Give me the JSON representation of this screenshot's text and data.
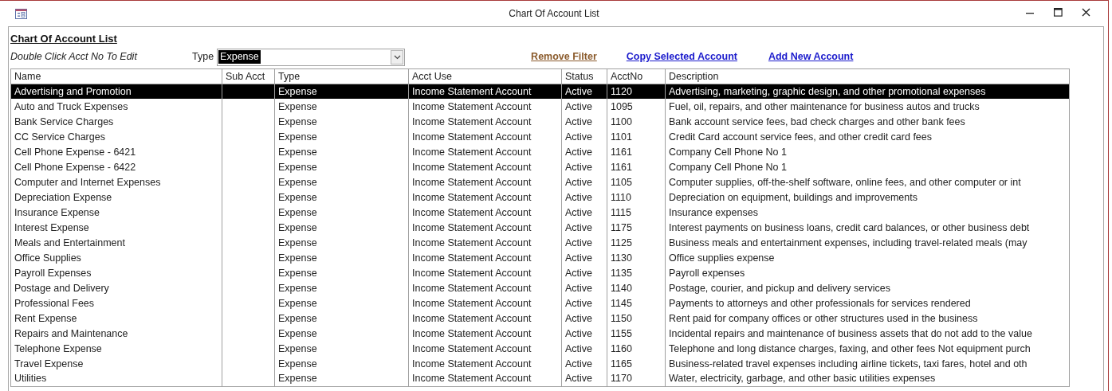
{
  "window": {
    "title": "Chart Of Account List"
  },
  "form": {
    "title": "Chart Of Account List",
    "hint": "Double Click Acct No To Edit",
    "type_filter": {
      "label": "Type",
      "value": "Expense"
    },
    "links": [
      {
        "label": "Remove Filter",
        "kind": "filter"
      },
      {
        "label": "Copy Selected Account",
        "kind": "action"
      },
      {
        "label": "Add New Account",
        "kind": "action"
      }
    ]
  },
  "table": {
    "columns": [
      "Name",
      "Sub Acct",
      "Type",
      "Acct Use",
      "Status",
      "AcctNo",
      "Description"
    ],
    "rows": [
      {
        "name": "Advertising and Promotion",
        "type": "Expense",
        "acct_use": "Income Statement Account",
        "status": "Active",
        "acct_no": "1120",
        "description": "Advertising, marketing, graphic design, and other promotional expenses",
        "selected": true
      },
      {
        "name": "Auto and Truck Expenses",
        "type": "Expense",
        "acct_use": "Income Statement Account",
        "status": "Active",
        "acct_no": "1095",
        "description": "Fuel, oil, repairs, and other maintenance for business autos and trucks",
        "selected": false
      },
      {
        "name": "Bank Service Charges",
        "type": "Expense",
        "acct_use": "Income Statement Account",
        "status": "Active",
        "acct_no": "1100",
        "description": "Bank account service fees, bad check charges and other bank fees",
        "selected": false
      },
      {
        "name": "CC Service Charges",
        "type": "Expense",
        "acct_use": "Income Statement Account",
        "status": "Active",
        "acct_no": "1101",
        "description": "Credit Card account service fees, and other credit card fees",
        "selected": false
      },
      {
        "name": "Cell Phone Expense - 6421",
        "type": "Expense",
        "acct_use": "Income Statement Account",
        "status": "Active",
        "acct_no": "1161",
        "description": "Company Cell Phone No 1",
        "selected": false
      },
      {
        "name": "Cell Phone Expense - 6422",
        "type": "Expense",
        "acct_use": "Income Statement Account",
        "status": "Active",
        "acct_no": "1161",
        "description": "Company Cell Phone No 1",
        "selected": false
      },
      {
        "name": "Computer and Internet Expenses",
        "type": "Expense",
        "acct_use": "Income Statement Account",
        "status": "Active",
        "acct_no": "1105",
        "description": "Computer supplies, off-the-shelf software, online fees, and other computer or int",
        "selected": false
      },
      {
        "name": "Depreciation Expense",
        "type": "Expense",
        "acct_use": "Income Statement Account",
        "status": "Active",
        "acct_no": "1110",
        "description": "Depreciation on equipment, buildings and improvements",
        "selected": false
      },
      {
        "name": "Insurance Expense",
        "type": "Expense",
        "acct_use": "Income Statement Account",
        "status": "Active",
        "acct_no": "1115",
        "description": "Insurance expenses",
        "selected": false
      },
      {
        "name": "Interest Expense",
        "type": "Expense",
        "acct_use": "Income Statement Account",
        "status": "Active",
        "acct_no": "1175",
        "description": "Interest payments on business loans, credit card balances, or other business debt",
        "selected": false
      },
      {
        "name": "Meals and Entertainment",
        "type": "Expense",
        "acct_use": "Income Statement Account",
        "status": "Active",
        "acct_no": "1125",
        "description": "Business meals and entertainment expenses, including travel-related meals (may",
        "selected": false
      },
      {
        "name": "Office Supplies",
        "type": "Expense",
        "acct_use": "Income Statement Account",
        "status": "Active",
        "acct_no": "1130",
        "description": "Office supplies expense",
        "selected": false
      },
      {
        "name": "Payroll Expenses",
        "type": "Expense",
        "acct_use": "Income Statement Account",
        "status": "Active",
        "acct_no": "1135",
        "description": "Payroll expenses",
        "selected": false
      },
      {
        "name": "Postage and Delivery",
        "type": "Expense",
        "acct_use": "Income Statement Account",
        "status": "Active",
        "acct_no": "1140",
        "description": "Postage, courier, and pickup and delivery services",
        "selected": false
      },
      {
        "name": "Professional Fees",
        "type": "Expense",
        "acct_use": "Income Statement Account",
        "status": "Active",
        "acct_no": "1145",
        "description": "Payments to attorneys and other professionals for services rendered",
        "selected": false
      },
      {
        "name": "Rent Expense",
        "type": "Expense",
        "acct_use": "Income Statement Account",
        "status": "Active",
        "acct_no": "1150",
        "description": "Rent paid for company offices or other structures used in the business",
        "selected": false
      },
      {
        "name": "Repairs and Maintenance",
        "type": "Expense",
        "acct_use": "Income Statement Account",
        "status": "Active",
        "acct_no": "1155",
        "description": "Incidental repairs and maintenance of business assets that do not add to the value",
        "selected": false
      },
      {
        "name": "Telephone Expense",
        "type": "Expense",
        "acct_use": "Income Statement Account",
        "status": "Active",
        "acct_no": "1160",
        "description": "Telephone and long distance charges, faxing, and other fees Not equipment purch",
        "selected": false
      },
      {
        "name": "Travel Expense",
        "type": "Expense",
        "acct_use": "Income Statement Account",
        "status": "Active",
        "acct_no": "1165",
        "description": "Business-related travel expenses including airline tickets, taxi fares, hotel and oth",
        "selected": false
      },
      {
        "name": "Utilities",
        "type": "Expense",
        "acct_use": "Income Statement Account",
        "status": "Active",
        "acct_no": "1170",
        "description": "Water, electricity, garbage, and other basic utilities expenses",
        "selected": false
      }
    ]
  }
}
